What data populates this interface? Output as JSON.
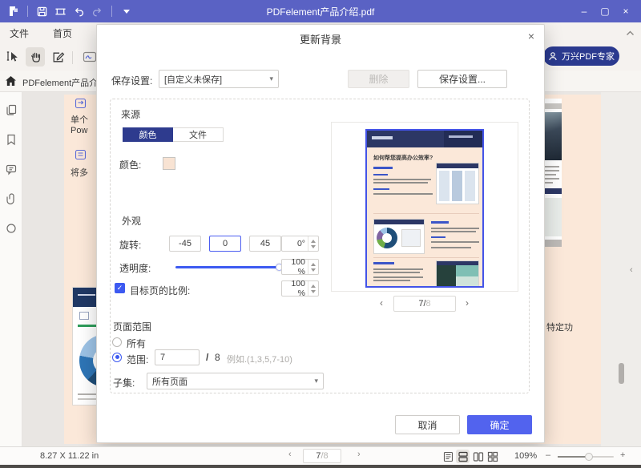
{
  "icons": {
    "caret_down": "▾",
    "chevron_left": "‹",
    "chevron_right": "›",
    "check": "✓"
  },
  "titlebar": {
    "title": "PDFelement产品介绍.pdf",
    "minimize": "–",
    "maximize": "▢",
    "close": "×"
  },
  "menubar": {
    "items": [
      "文件",
      "首页"
    ]
  },
  "toolbar": {
    "expert_button": "万兴PDF专家"
  },
  "tabbar": {
    "active_tab": "PDFelement产品介..."
  },
  "dialog": {
    "title": "更新背景",
    "close": "×",
    "save_settings_label": "保存设置:",
    "save_settings_value": "[自定义未保存]",
    "delete_button": "删除",
    "save_button": "保存设置...",
    "source": {
      "label": "来源",
      "tab_color": "颜色",
      "tab_file": "文件",
      "color_label": "颜色:",
      "color_value": "#f8e3d3"
    },
    "appearance": {
      "label": "外观",
      "rotation_label": "旋转:",
      "preset_minus45": "-45",
      "preset_zero": "0",
      "preset_45": "45",
      "rotation_value": "0°",
      "opacity_label": "透明度:",
      "opacity_value": "100 %",
      "scale_label": "目标页的比例:",
      "scale_checked": true,
      "scale_value": "100 %"
    },
    "page_range": {
      "label": "页面范围",
      "all_label": "所有",
      "range_label": "范围:",
      "range_value": "7",
      "range_divider": "/",
      "range_total": "8",
      "range_hint": "例如.(1,3,5,7-10)",
      "subset_label": "子集:",
      "subset_value": "所有页面"
    },
    "preview": {
      "page_title": "如何帮您提高办公效率?",
      "pagination_current": "7/",
      "pagination_total": "8"
    },
    "cancel_button": "取消",
    "ok_button": "确定"
  },
  "document": {
    "snippet_line1": "单个",
    "snippet_line2": "Pow",
    "snippet_line3": "将多",
    "right_snippet": "特定功"
  },
  "statusbar": {
    "page_size": "8.27 X 11.22 in",
    "page_current": "7",
    "page_total": "/8",
    "zoom_level": "109%",
    "zoom_out": "–",
    "zoom_in": "+"
  },
  "colors": {
    "titlebar": "#5a62c4",
    "accent_blue": "#3d5af1",
    "primary_button": "#5263ee",
    "dark_navy": "#2b3a8f",
    "page_peach": "#fbe8d9"
  }
}
